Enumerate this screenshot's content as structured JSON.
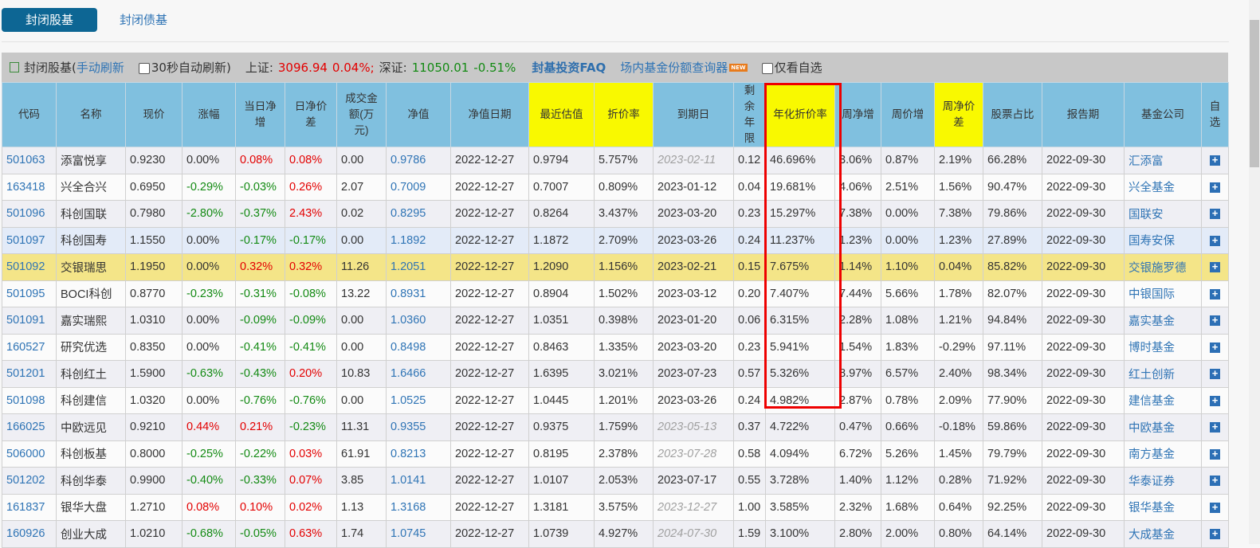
{
  "tabs": [
    "封闭股基",
    "封闭债基"
  ],
  "toolbar": {
    "title": "封闭股基(",
    "manual_refresh": "手动刷新",
    "auto_refresh": "30秒自动刷新)",
    "sh_label": "上证:",
    "sh_value": "3096.94",
    "sh_change": "0.04%;",
    "sz_label": "深证:",
    "sz_value": "11050.01",
    "sz_change": "-0.51%",
    "faq": "封基投资FAQ",
    "query": "场内基金份额查询器",
    "new_badge": "NEW",
    "only_fav": "仅看自选"
  },
  "columns": [
    "代码",
    "名称",
    "现价",
    "涨幅",
    "当日净增",
    "日净价差",
    "成交金额(万元)",
    "净值",
    "净值日期",
    "最近估值",
    "折价率",
    "到期日",
    "剩余年限",
    "年化折价率",
    "周净增",
    "周价增",
    "周净价差",
    "股票占比",
    "报告期",
    "基金公司",
    "自选"
  ],
  "rows": [
    [
      "501063",
      "添富悦享",
      "0.9230",
      "0.00%",
      "0.08%",
      "0.08%",
      "0.00",
      "0.9786",
      "2022-12-27",
      "0.9794",
      "5.757%",
      "2023-02-11",
      "0.12",
      "46.696%",
      "3.06%",
      "0.87%",
      "2.19%",
      "66.28%",
      "2022-09-30",
      "汇添富"
    ],
    [
      "163418",
      "兴全合兴",
      "0.6950",
      "-0.29%",
      "-0.03%",
      "0.26%",
      "2.07",
      "0.7009",
      "2022-12-27",
      "0.7007",
      "0.809%",
      "2023-01-12",
      "0.04",
      "19.681%",
      "4.06%",
      "2.51%",
      "1.56%",
      "90.47%",
      "2022-09-30",
      "兴全基金"
    ],
    [
      "501096",
      "科创国联",
      "0.7980",
      "-2.80%",
      "-0.37%",
      "2.43%",
      "0.02",
      "0.8295",
      "2022-12-27",
      "0.8264",
      "3.437%",
      "2023-03-20",
      "0.23",
      "15.297%",
      "7.38%",
      "0.00%",
      "7.38%",
      "79.86%",
      "2022-09-30",
      "国联安"
    ],
    [
      "501097",
      "科创国寿",
      "1.1550",
      "0.00%",
      "-0.17%",
      "-0.17%",
      "0.00",
      "1.1892",
      "2022-12-27",
      "1.1872",
      "2.709%",
      "2023-03-26",
      "0.24",
      "11.237%",
      "1.23%",
      "0.00%",
      "1.23%",
      "27.89%",
      "2022-09-30",
      "国寿安保"
    ],
    [
      "501092",
      "交银瑞思",
      "1.1950",
      "0.00%",
      "0.32%",
      "0.32%",
      "11.26",
      "1.2051",
      "2022-12-27",
      "1.2090",
      "1.156%",
      "2023-02-21",
      "0.15",
      "7.675%",
      "1.14%",
      "1.10%",
      "0.04%",
      "85.82%",
      "2022-09-30",
      "交银施罗德"
    ],
    [
      "501095",
      "BOCI科创",
      "0.8770",
      "-0.23%",
      "-0.31%",
      "-0.08%",
      "13.22",
      "0.8931",
      "2022-12-27",
      "0.8904",
      "1.502%",
      "2023-03-12",
      "0.20",
      "7.407%",
      "7.44%",
      "5.66%",
      "1.78%",
      "82.07%",
      "2022-09-30",
      "中银国际"
    ],
    [
      "501091",
      "嘉实瑞熙",
      "1.0310",
      "0.00%",
      "-0.09%",
      "-0.09%",
      "0.00",
      "1.0360",
      "2022-12-27",
      "1.0351",
      "0.398%",
      "2023-01-20",
      "0.06",
      "6.315%",
      "2.28%",
      "1.08%",
      "1.21%",
      "94.84%",
      "2022-09-30",
      "嘉实基金"
    ],
    [
      "160527",
      "研究优选",
      "0.8350",
      "0.00%",
      "-0.41%",
      "-0.41%",
      "0.00",
      "0.8498",
      "2022-12-27",
      "0.8463",
      "1.335%",
      "2023-03-20",
      "0.23",
      "5.941%",
      "1.54%",
      "1.83%",
      "-0.29%",
      "97.11%",
      "2022-09-30",
      "博时基金"
    ],
    [
      "501201",
      "科创红土",
      "1.5900",
      "-0.63%",
      "-0.43%",
      "0.20%",
      "10.83",
      "1.6466",
      "2022-12-27",
      "1.6395",
      "3.021%",
      "2023-07-23",
      "0.57",
      "5.326%",
      "8.97%",
      "6.57%",
      "2.40%",
      "98.34%",
      "2022-09-30",
      "红土创新"
    ],
    [
      "501098",
      "科创建信",
      "1.0320",
      "0.00%",
      "-0.76%",
      "-0.76%",
      "0.00",
      "1.0525",
      "2022-12-27",
      "1.0445",
      "1.201%",
      "2023-03-26",
      "0.24",
      "4.982%",
      "2.87%",
      "0.78%",
      "2.09%",
      "77.90%",
      "2022-09-30",
      "建信基金"
    ],
    [
      "166025",
      "中欧远见",
      "0.9210",
      "0.44%",
      "0.21%",
      "-0.23%",
      "11.31",
      "0.9355",
      "2022-12-27",
      "0.9375",
      "1.759%",
      "2023-05-13",
      "0.37",
      "4.722%",
      "0.47%",
      "0.66%",
      "-0.18%",
      "59.86%",
      "2022-09-30",
      "中欧基金"
    ],
    [
      "506000",
      "科创板基",
      "0.8000",
      "-0.25%",
      "-0.22%",
      "0.03%",
      "61.91",
      "0.8213",
      "2022-12-27",
      "0.8195",
      "2.378%",
      "2023-07-28",
      "0.58",
      "4.094%",
      "6.72%",
      "5.26%",
      "1.45%",
      "79.79%",
      "2022-09-30",
      "南方基金"
    ],
    [
      "501202",
      "科创华泰",
      "0.9900",
      "-0.40%",
      "-0.33%",
      "0.07%",
      "3.85",
      "1.0141",
      "2022-12-27",
      "1.0107",
      "2.053%",
      "2023-07-17",
      "0.55",
      "3.728%",
      "1.40%",
      "1.12%",
      "0.28%",
      "71.92%",
      "2022-09-30",
      "华泰证券"
    ],
    [
      "161837",
      "银华大盘",
      "1.2710",
      "0.08%",
      "0.10%",
      "0.02%",
      "1.13",
      "1.3168",
      "2022-12-27",
      "1.3181",
      "3.575%",
      "2023-12-27",
      "1.00",
      "3.585%",
      "2.32%",
      "1.68%",
      "0.64%",
      "92.25%",
      "2022-09-30",
      "银华基金"
    ],
    [
      "160926",
      "创业大成",
      "1.0210",
      "-0.68%",
      "-0.05%",
      "0.63%",
      "1.74",
      "1.0745",
      "2022-12-27",
      "1.0739",
      "4.927%",
      "2024-07-30",
      "1.59",
      "3.100%",
      "2.80%",
      "2.00%",
      "0.80%",
      "64.14%",
      "2022-09-30",
      "大成基金"
    ]
  ],
  "gray_date_rows": [
    0,
    10,
    11,
    13,
    14
  ],
  "highlight_row": 3,
  "selected_row": 4,
  "colors": {
    "accent": "#0d6694",
    "up": "#e30000",
    "down": "#138a13",
    "header": "#80c0df",
    "highlight_header": "#f9f900"
  }
}
